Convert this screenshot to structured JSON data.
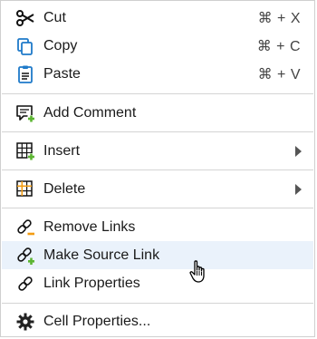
{
  "menu": {
    "items": {
      "cut": {
        "label": "Cut",
        "shortcut": "⌘ + X",
        "icon": "scissors-icon"
      },
      "copy": {
        "label": "Copy",
        "shortcut": "⌘ + C",
        "icon": "copy-icon"
      },
      "paste": {
        "label": "Paste",
        "shortcut": "⌘ + V",
        "icon": "clipboard-icon"
      },
      "add_comment": {
        "label": "Add Comment",
        "icon": "add-comment-icon"
      },
      "insert": {
        "label": "Insert",
        "icon": "grid-insert-icon",
        "has_submenu": true
      },
      "delete": {
        "label": "Delete",
        "icon": "grid-delete-icon",
        "has_submenu": true
      },
      "remove_links": {
        "label": "Remove Links",
        "icon": "link-remove-icon"
      },
      "make_source_link": {
        "label": "Make Source Link",
        "icon": "link-add-icon",
        "hovered": true
      },
      "link_properties": {
        "label": "Link Properties",
        "icon": "link-icon"
      },
      "cell_properties": {
        "label": "Cell Properties...",
        "icon": "gear-icon"
      }
    }
  },
  "colors": {
    "accent_blue": "#1f7ac9",
    "accent_green": "#5cb532",
    "accent_orange": "#f39c12",
    "hover_bg": "#eaf2fb"
  }
}
